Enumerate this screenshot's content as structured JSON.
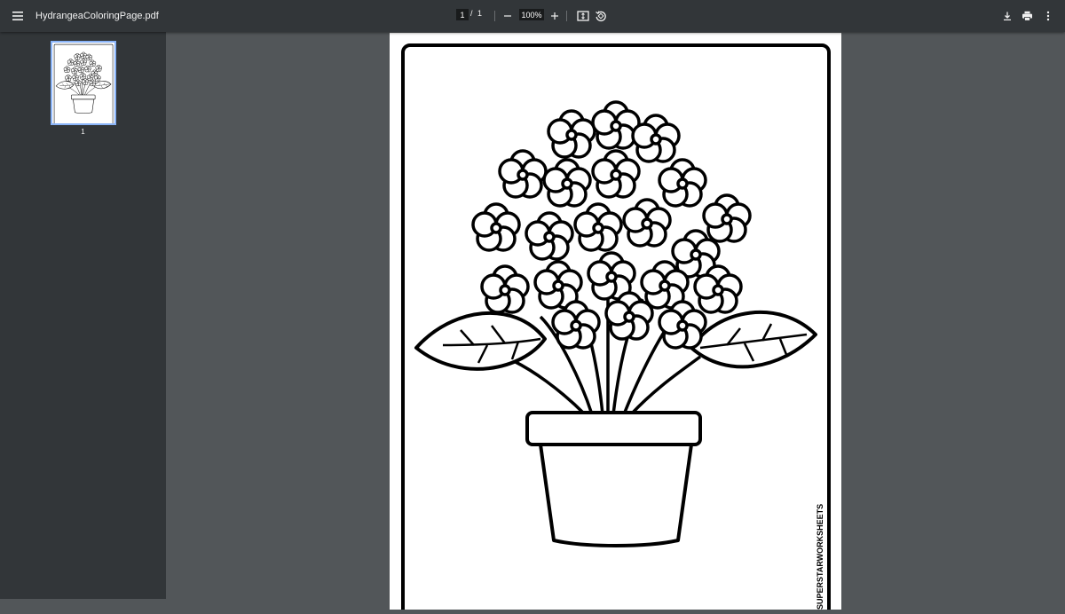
{
  "toolbar": {
    "title": "HydrangeaColoringPage.pdf",
    "page_current": "1",
    "page_separator": "/",
    "page_total": "1",
    "zoom": "100%"
  },
  "icons": {
    "menu": "menu-icon",
    "zoom_out": "minus-icon",
    "zoom_in": "plus-icon",
    "fit": "fit-page-icon",
    "rotate": "rotate-icon",
    "download": "download-icon",
    "print": "print-icon",
    "more": "more-vert-icon"
  },
  "sidebar": {
    "thumbnails": [
      {
        "label": "1"
      }
    ]
  },
  "document": {
    "watermark": "SUPERSTARWORKSHEETS"
  },
  "colors": {
    "toolbar_bg": "#323639",
    "viewer_bg": "#525659",
    "thumb_border": "#8ab4f8"
  }
}
